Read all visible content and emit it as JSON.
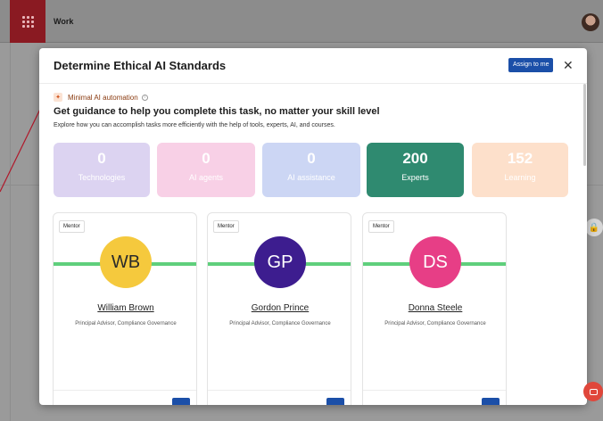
{
  "app": {
    "workspace_label": "Work"
  },
  "modal": {
    "title": "Determine Ethical AI Standards",
    "assign_button": "Assign to me",
    "close_glyph": "✕",
    "automation_label": "Minimal AI automation",
    "guidance_title": "Get guidance to help you complete this task, no matter your skill level",
    "guidance_subtitle": "Explore how you can accomplish tasks more efficiently with the help of tools, experts, AI, and courses.",
    "stats": [
      {
        "value": "0",
        "label": "Technologies"
      },
      {
        "value": "0",
        "label": "AI agents"
      },
      {
        "value": "0",
        "label": "AI assistance"
      },
      {
        "value": "200",
        "label": "Experts"
      },
      {
        "value": "152",
        "label": "Learning"
      }
    ],
    "mentors": [
      {
        "badge": "Mentor",
        "initials": "WB",
        "name": "William Brown",
        "role": "Principal Advisor, Compliance Governance"
      },
      {
        "badge": "Mentor",
        "initials": "GP",
        "name": "Gordon Prince",
        "role": "Principal Advisor, Compliance Governance"
      },
      {
        "badge": "Mentor",
        "initials": "DS",
        "name": "Donna Steele",
        "role": "Principal Advisor, Compliance Governance"
      }
    ]
  },
  "colors": {
    "brand_red": "#8a1a22",
    "primary_blue": "#1b4fa8",
    "experts_green": "#2f8a70",
    "mentor_bar_green": "#5fcf7c"
  },
  "icons": {
    "apps": "apps-grid-icon",
    "automation": "sparkle-icon",
    "info": "info-icon",
    "lock": "lock-icon",
    "chat": "chat-icon"
  }
}
